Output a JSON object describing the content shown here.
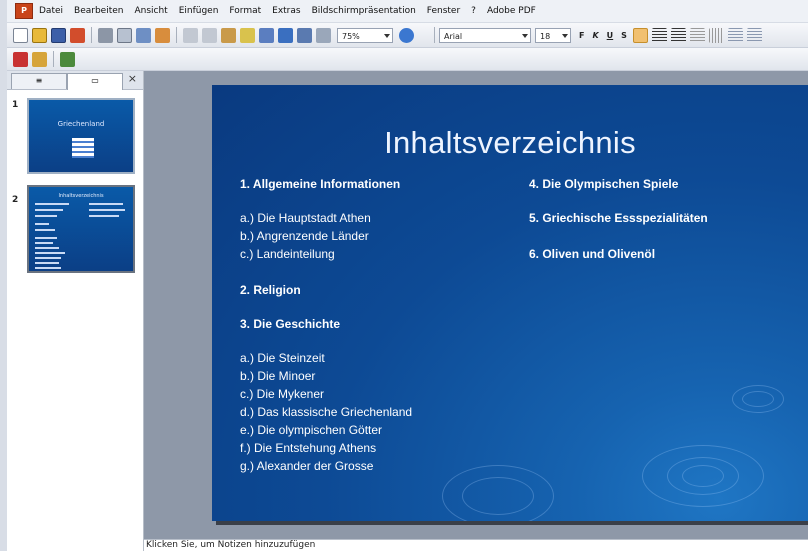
{
  "menu": [
    "Datei",
    "Bearbeiten",
    "Ansicht",
    "Einfügen",
    "Format",
    "Extras",
    "Bildschirmpräsentation",
    "Fenster",
    "?",
    "Adobe PDF"
  ],
  "toolbar": {
    "zoom": "75%",
    "font": "Arial",
    "size": "18",
    "bold": "F",
    "italic": "K",
    "underline": "U",
    "shadow": "S"
  },
  "pane": {
    "tab_outline_icon": "outline-icon",
    "tab_slides_icon": "slides-icon",
    "close": "×"
  },
  "thumbnails": [
    {
      "number": "1",
      "title": "Griechenland"
    },
    {
      "number": "2",
      "title": "Inhaltsverzeichnis"
    }
  ],
  "slide": {
    "title": "Inhaltsverzeichnis",
    "left": {
      "h1": "1. Allgemeine Informationen",
      "sub1": [
        "a.) Die Hauptstadt Athen",
        "b.) Angrenzende Länder",
        "c.) Landeinteilung"
      ],
      "h2": "2. Religion",
      "h3": "3. Die Geschichte",
      "sub3": [
        "a.) Die Steinzeit",
        "b.) Die Minoer",
        "c.) Die Mykener",
        "d.) Das klassische Griechenland",
        "e.) Die olympischen Götter",
        " f.) Die Entstehung Athens",
        "g.) Alexander der Grosse"
      ]
    },
    "right": {
      "h4": "4. Die Olympischen Spiele",
      "h5": "5. Griechische Essspezialitäten",
      "h6": "6. Oliven und Olivenöl"
    }
  },
  "notes_placeholder": "Klicken Sie, um Notizen hinzuzufügen"
}
